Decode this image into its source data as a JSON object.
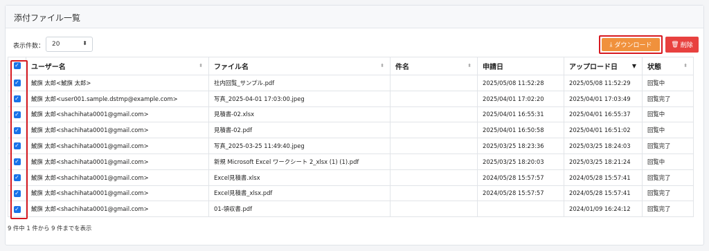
{
  "panel": {
    "title": "添付ファイル一覧"
  },
  "toolbar": {
    "length_label": "表示件数：",
    "length_value": "20",
    "download_label": "ダウンロード",
    "delete_label": "削除"
  },
  "table": {
    "headers": [
      "",
      "ユーザー名",
      "ファイル名",
      "件名",
      "申請日",
      "アップロード日",
      "状態"
    ],
    "rows": [
      [
        "鯱旗 太郎<鯱旗 太郎>",
        "社内回覧_サンプル.pdf",
        "",
        "2025/05/08 11:52:28",
        "2025/05/08 11:52:29",
        "回覧中"
      ],
      [
        "鯱旗 太郎<user001.sample.dstmp@example.com>",
        "写真_2025-04-01 17:03:00.jpeg",
        "",
        "2025/04/01 17:02:20",
        "2025/04/01 17:03:49",
        "回覧完了"
      ],
      [
        "鯱旗 太郎<shachihata0001@gmail.com>",
        "見積書-02.xlsx",
        "",
        "2025/04/01 16:55:31",
        "2025/04/01 16:55:37",
        "回覧中"
      ],
      [
        "鯱旗 太郎<shachihata0001@gmail.com>",
        "見積書-02.pdf",
        "",
        "2025/04/01 16:50:58",
        "2025/04/01 16:51:02",
        "回覧中"
      ],
      [
        "鯱旗 太郎<shachihata0001@gmail.com>",
        "写真_2025-03-25 11:49:40.jpeg",
        "",
        "2025/03/25 18:23:36",
        "2025/03/25 18:24:03",
        "回覧完了"
      ],
      [
        "鯱旗 太郎<shachihata0001@gmail.com>",
        "新規 Microsoft Excel ワークシート 2_xlsx (1) (1).pdf",
        "",
        "2025/03/25 18:20:03",
        "2025/03/25 18:21:24",
        "回覧中"
      ],
      [
        "鯱旗 太郎<shachihata0001@gmail.com>",
        "Excel見積書.xlsx",
        "",
        "2024/05/28 15:57:57",
        "2024/05/28 15:57:41",
        "回覧完了"
      ],
      [
        "鯱旗 太郎<shachihata0001@gmail.com>",
        "Excel見積書_xlsx.pdf",
        "",
        "2024/05/28 15:57:57",
        "2024/05/28 15:57:41",
        "回覧完了"
      ],
      [
        "鯱旗 太郎<shachihata0001@gmail.com>",
        "01-領収書.pdf",
        "",
        "",
        "2024/01/09 16:24:12",
        "回覧完了"
      ]
    ]
  },
  "footer": {
    "info": "9 件中 1 件から 9 件までを表示"
  },
  "colors": {
    "download": "#f0913c",
    "delete": "#e8413f",
    "checkbox": "#1a73e8",
    "highlight": "#d71920"
  },
  "icons": {
    "download": "download-icon",
    "delete": "trash-icon",
    "sort": "sort-icon",
    "sort_desc": "sort-desc-icon"
  }
}
